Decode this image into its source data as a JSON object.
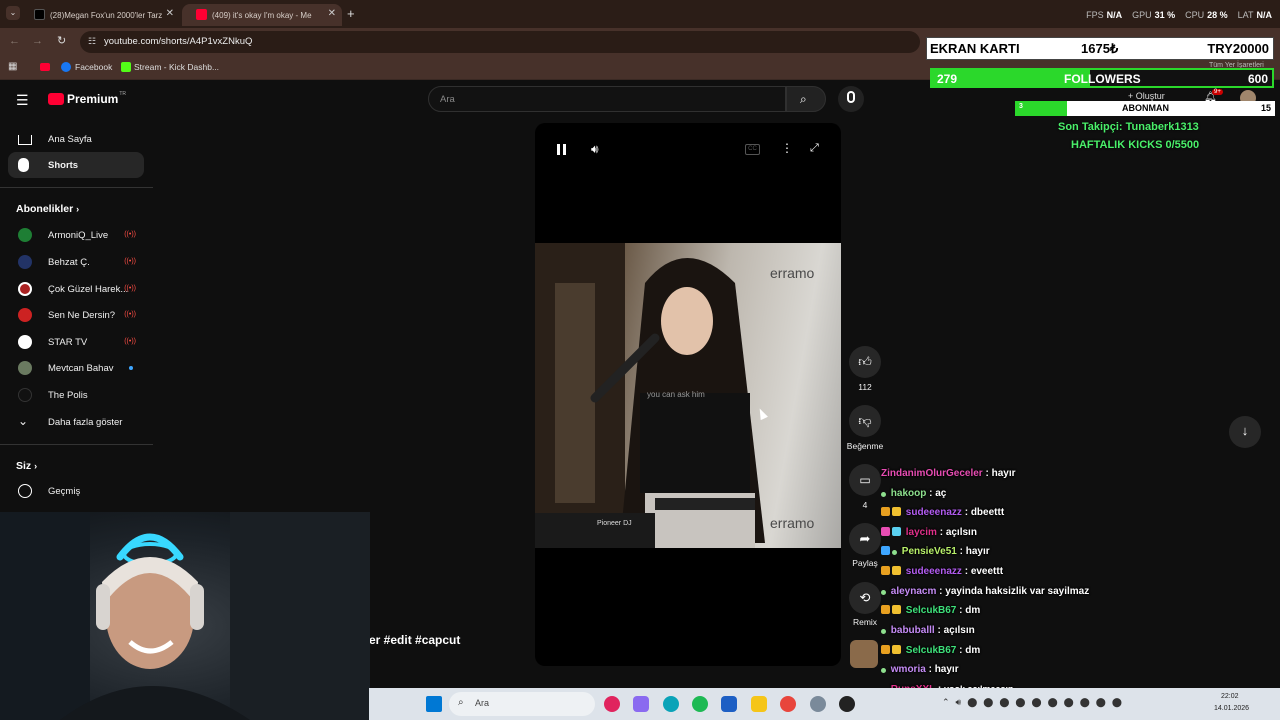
{
  "browser": {
    "tabs": [
      {
        "label": "(28)Megan Fox'un 2000'ler Tarz",
        "active": false
      },
      {
        "label": "(409) it's okay I'm okay - Me",
        "active": true
      }
    ],
    "url": "youtube.com/shorts/A4P1vxZNkuQ",
    "bookmarks": [
      "Facebook",
      "Stream - Kick Dashb..."
    ],
    "all_bookmarks": "Tüm Yer İşaretleri"
  },
  "hud": {
    "fps_label": "FPS",
    "fps": "N/A",
    "gpu_label": "GPU",
    "gpu": "31 %",
    "cpu_label": "CPU",
    "cpu": "28 %",
    "lat_label": "LAT",
    "lat": "N/A"
  },
  "youtube": {
    "logo": "Premium",
    "logo_region": "TR",
    "search_placeholder": "Ara",
    "create": "Oluştur",
    "notif_badge": "9+",
    "sidebar": {
      "home": "Ana Sayfa",
      "shorts": "Shorts",
      "subs_header": "Abonelikler",
      "subs": [
        {
          "name": "ArmoniQ_Live",
          "status": "live",
          "color": "#1e7e34"
        },
        {
          "name": "Behzat Ç.",
          "status": "live",
          "color": "#223366"
        },
        {
          "name": "Çok Güzel Harek...",
          "status": "live",
          "color": "#aa2222"
        },
        {
          "name": "Sen Ne Dersin?",
          "status": "live",
          "color": "#cc2222"
        },
        {
          "name": "STAR TV",
          "status": "live",
          "color": "#ffffff"
        },
        {
          "name": "Mevtcan Bahav",
          "status": "new",
          "color": "#6a7a60"
        },
        {
          "name": "The Polis",
          "status": "none",
          "color": "#111111"
        }
      ],
      "show_more": "Daha fazla göster",
      "you": "Siz",
      "history": "Geçmiş"
    },
    "video_caption": "you can ask him",
    "desc": "er #edit #capcut",
    "actions": {
      "likes": "112",
      "dislike": "Beğenme",
      "comments": "4",
      "share": "Paylaş",
      "remix": "Remix"
    }
  },
  "overlay": {
    "gpu_title": "EKRAN KARTI",
    "gpu_price": "1675₺",
    "gpu_goal": "TRY20000",
    "followers_count": "279",
    "followers_label": "FOLLOWERS",
    "followers_goal": "600",
    "followers_progress": 0.465,
    "sub_count": "3",
    "sub_label": "ABONMAN",
    "sub_goal": "15",
    "sub_progress": 0.2,
    "last_follower": "Son Takipçi: Tunaberk1313",
    "weekly_kicks": "HAFTALIK KICKS 0/5500"
  },
  "chat": [
    {
      "user": "ZindanimOlurGeceler",
      "msg": "hayır",
      "color": "#e84db3"
    },
    {
      "user": "hakoop",
      "msg": "aç",
      "color": "#8ee08e"
    },
    {
      "user": "sudeeenazz",
      "msg": "dbeettt",
      "color": "#b25cf0"
    },
    {
      "user": "laycim",
      "msg": "açılsın",
      "color": "#e0308a"
    },
    {
      "user": "PensieVe51",
      "msg": "hayır",
      "color": "#b8f06a"
    },
    {
      "user": "sudeeenazz",
      "msg": "eveettt",
      "color": "#b25cf0"
    },
    {
      "user": "aleynacm",
      "msg": "yayinda haksizlik var sayilmaz",
      "color": "#c58cf5"
    },
    {
      "user": "SelcukB67",
      "msg": "dm",
      "color": "#3ee07a"
    },
    {
      "user": "babuballl",
      "msg": "açılsın",
      "color": "#c58cf5"
    },
    {
      "user": "SelcukB67",
      "msg": "dm",
      "color": "#3ee07a"
    },
    {
      "user": "wmoria",
      "msg": "hayır",
      "color": "#c58cf5"
    },
    {
      "user": "RunsXXL",
      "msg": "yook açılmaasın",
      "color": "#e0308a"
    }
  ],
  "taskbar": {
    "search": "Ara",
    "time": "22:02",
    "date": "14.01.2026"
  }
}
